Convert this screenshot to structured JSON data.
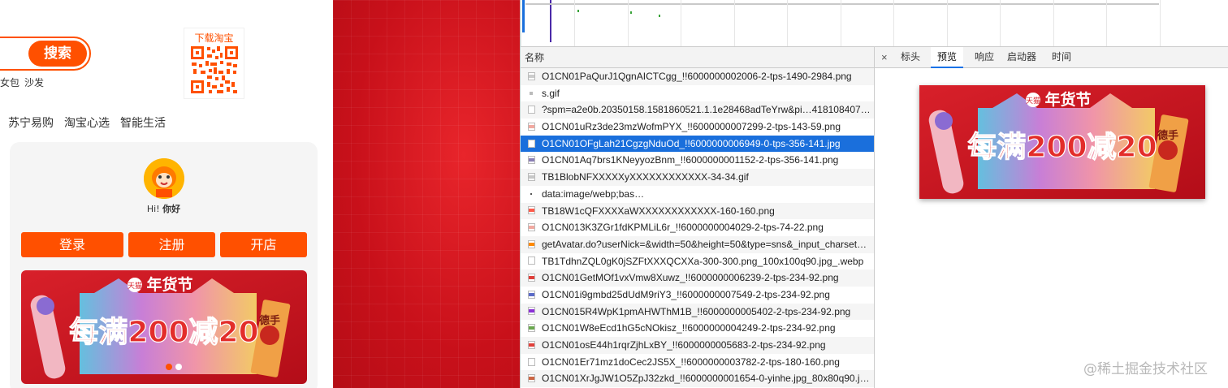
{
  "page": {
    "search_button": "搜索",
    "hot_words": [
      "女包",
      "沙发"
    ],
    "qr_title": "下载淘宝",
    "nav_links": [
      "苏宁易购",
      "淘宝心选",
      "智能生活"
    ],
    "greeting_prefix": "Hi!",
    "greeting": "你好",
    "login_button": "登录",
    "register_button": "注册",
    "open_shop_button": "开店",
    "banner": {
      "brand": "天猫",
      "title": "年货节",
      "slogan": "每满200减20",
      "side_label": "德手"
    }
  },
  "devtools": {
    "name_header": "名称",
    "tabs": [
      "标头",
      "预览",
      "响应",
      "启动器",
      "时间"
    ],
    "active_tab": "预览",
    "close_icon": "×",
    "selected_row": 4,
    "rows": [
      {
        "name": "O1CN01PaQurJ1QgnAICTCgg_!!6000000002006-2-tps-1490-2984.png",
        "icon": "file"
      },
      {
        "name": "s.gif",
        "icon": "gif"
      },
      {
        "name": "?spm=a2e0b.20350158.1581860521.1.1e28468adTeYrw&pi…418108407…",
        "icon": "doc"
      },
      {
        "name": "O1CN01uRz3de23mzWofmPYX_!!6000000007299-2-tps-143-59.png",
        "icon": "file"
      },
      {
        "name": "O1CN01OFgLah21CgzgNduOd_!!6000000006949-0-tps-356-141.jpg",
        "icon": "file"
      },
      {
        "name": "O1CN01Aq7brs1KNeyyozBnm_!!6000000001152-2-tps-356-141.png",
        "icon": "file"
      },
      {
        "name": "TB1BlobNFXXXXXyXXXXXXXXXXXX-34-34.gif",
        "icon": "file"
      },
      {
        "name": "data:image/webp;bas…",
        "icon": "dot"
      },
      {
        "name": "TB18W1cQFXXXXaWXXXXXXXXXXXX-160-160.png",
        "icon": "file"
      },
      {
        "name": "O1CN013K3ZGr1fdKPMLiL6r_!!6000000004029-2-tps-74-22.png",
        "icon": "file"
      },
      {
        "name": "getAvatar.do?userNick=&width=50&height=50&type=sns&_input_charset…",
        "icon": "file"
      },
      {
        "name": "TB1TdhnZQL0gK0jSZFtXXXQCXXa-300-300.png_100x100q90.jpg_.webp",
        "icon": "doc"
      },
      {
        "name": "O1CN01GetMOf1vxVmw8Xuwz_!!6000000006239-2-tps-234-92.png",
        "icon": "file"
      },
      {
        "name": "O1CN01i9gmbd25dUdM9riY3_!!6000000007549-2-tps-234-92.png",
        "icon": "file"
      },
      {
        "name": "O1CN015R4WpK1pmAHWThM1B_!!6000000005402-2-tps-234-92.png",
        "icon": "file"
      },
      {
        "name": "O1CN01W8eEcd1hG5cNOkisz_!!6000000004249-2-tps-234-92.png",
        "icon": "file"
      },
      {
        "name": "O1CN01osE44h1rqrZjhLxBY_!!6000000005683-2-tps-234-92.png",
        "icon": "file"
      },
      {
        "name": "O1CN01Er71mz1doCec2JS5X_!!6000000003782-2-tps-180-160.png",
        "icon": "doc"
      },
      {
        "name": "O1CN01XrJgJW1O5ZpJ32zkd_!!6000000001654-0-yinhe.jpg_80x80q90.j…",
        "icon": "file"
      }
    ],
    "icon_colors": [
      "#cccccc",
      "#bbbbbb",
      "#ffffff",
      "#f2a9a0",
      "#ffffff",
      "#8a7fb5",
      "#c7c7c7",
      "#555555",
      "#ff5a4a",
      "#f2a9a0",
      "#ff8a00",
      "#ffffff",
      "#e0403a",
      "#5b6bc8",
      "#8b2fd6",
      "#6aa84f",
      "#e0403a",
      "#ffffff",
      "#cc6644"
    ]
  },
  "watermark": "@稀土掘金技术社区",
  "colors": {
    "accent_orange": "#ff5000",
    "devtools_select": "#1a6fdc",
    "tab_underline": "#1a73e8",
    "background_red": "#d9141b"
  }
}
